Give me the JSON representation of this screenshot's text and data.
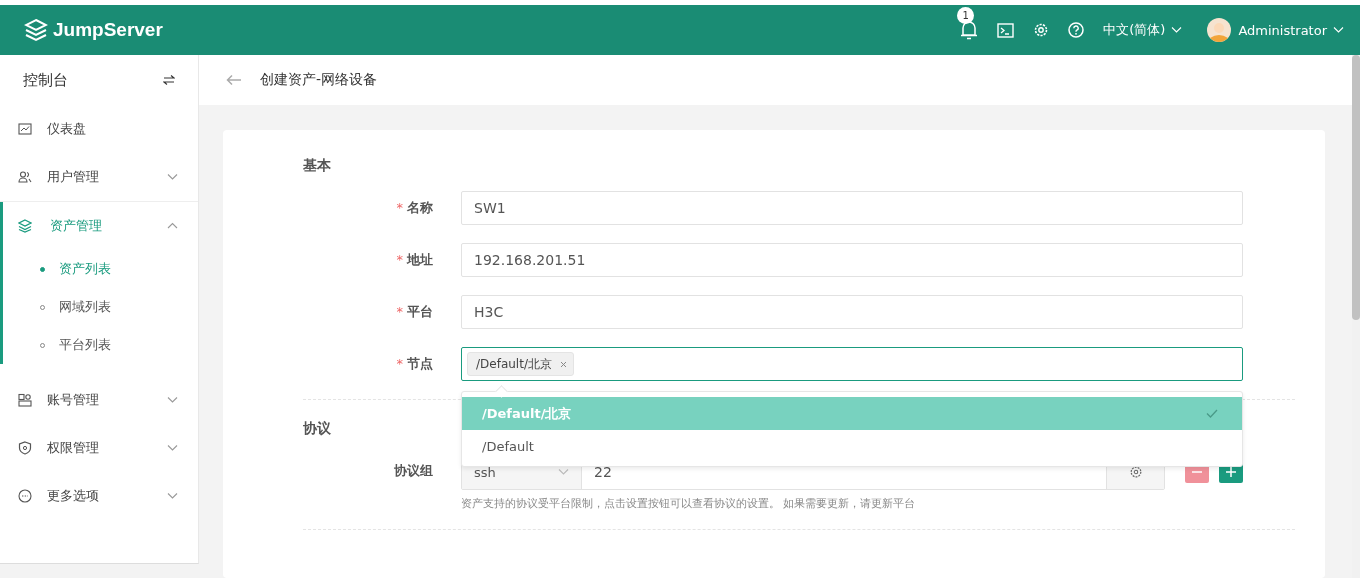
{
  "header": {
    "logo_text": "JumpServer",
    "notification_count": "1",
    "language": "中文(简体)",
    "user": "Administrator"
  },
  "sidebar": {
    "title": "控制台",
    "items": [
      {
        "label": "仪表盘",
        "selected": false
      },
      {
        "label": "用户管理",
        "selected": false,
        "expanded": false
      },
      {
        "label": "资产管理",
        "selected": true,
        "expanded": true,
        "children": [
          {
            "label": "资产列表",
            "selected": true
          },
          {
            "label": "网域列表",
            "selected": false
          },
          {
            "label": "平台列表",
            "selected": false
          }
        ]
      },
      {
        "label": "账号管理",
        "selected": false,
        "expanded": false
      },
      {
        "label": "权限管理",
        "selected": false,
        "expanded": false
      },
      {
        "label": "更多选项",
        "selected": false,
        "expanded": false
      }
    ]
  },
  "page": {
    "title": "创建资产-网络设备"
  },
  "sections": [
    {
      "title": "基本",
      "fields": [
        {
          "kind": "input",
          "label": "名称",
          "required_mark": "*",
          "value": "SW1"
        },
        {
          "kind": "input",
          "label": "地址",
          "required_mark": "*",
          "value": "192.168.201.51"
        },
        {
          "kind": "input",
          "label": "平台",
          "required_mark": "*",
          "value": "H3C"
        },
        {
          "kind": "tags",
          "label": "节点",
          "required_mark": "*",
          "focused": true,
          "tags": [
            "/Default/北京"
          ],
          "dropdown": {
            "options": [
              {
                "label": "/Default/北京",
                "selected": true
              },
              {
                "label": "/Default",
                "selected": false
              }
            ]
          }
        }
      ]
    },
    {
      "title": "协议",
      "fields": [
        {
          "kind": "protocol",
          "label": "协议组",
          "protocol": "ssh",
          "port": "22",
          "hint": "资产支持的协议受平台限制，点击设置按钮可以查看协议的设置。 如果需要更新，请更新平台"
        }
      ]
    }
  ]
}
